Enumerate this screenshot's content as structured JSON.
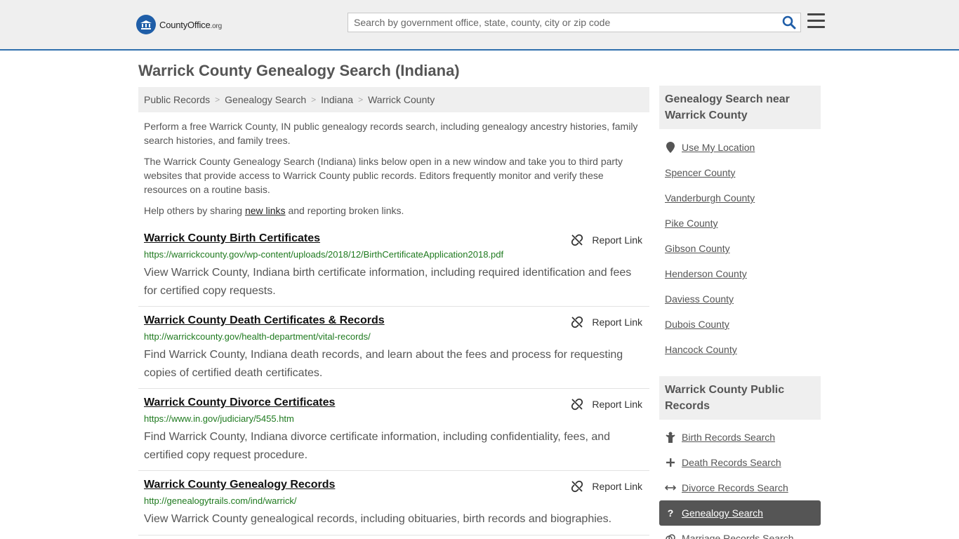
{
  "header": {
    "logo_main": "CountyOffice",
    "logo_tld": ".org",
    "search_placeholder": "Search by government office, state, county, city or zip code"
  },
  "page_title": "Warrick County Genealogy Search (Indiana)",
  "breadcrumb": [
    "Public Records",
    "Genealogy Search",
    "Indiana",
    "Warrick County"
  ],
  "intro": {
    "p1": "Perform a free Warrick County, IN public genealogy records search, including genealogy ancestry histories, family search histories, and family trees.",
    "p2": "The Warrick County Genealogy Search (Indiana) links below open in a new window and take you to third party websites that provide access to Warrick County public records. Editors frequently monitor and verify these resources on a routine basis.",
    "p3_before": "Help others by sharing ",
    "p3_link": "new links",
    "p3_after": " and reporting broken links."
  },
  "report_label": "Report Link",
  "results": [
    {
      "title": "Warrick County Birth Certificates",
      "url": "https://warrickcounty.gov/wp-content/uploads/2018/12/BirthCertificateApplication2018.pdf",
      "desc": "View Warrick County, Indiana birth certificate information, including required identification and fees for certified copy requests."
    },
    {
      "title": "Warrick County Death Certificates & Records",
      "url": "http://warrickcounty.gov/health-department/vital-records/",
      "desc": "Find Warrick County, Indiana death records, and learn about the fees and process for requesting copies of certified death certificates."
    },
    {
      "title": "Warrick County Divorce Certificates",
      "url": "https://www.in.gov/judiciary/5455.htm",
      "desc": "Find Warrick County, Indiana divorce certificate information, including confidentiality, fees, and certified copy request procedure."
    },
    {
      "title": "Warrick County Genealogy Records",
      "url": "http://genealogytrails.com/ind/warrick/",
      "desc": "View Warrick County genealogical records, including obituaries, birth records and biographies."
    }
  ],
  "sidebar": {
    "nearby_title": "Genealogy Search near Warrick County",
    "use_location": "Use My Location",
    "nearby": [
      "Spencer County",
      "Vanderburgh County",
      "Pike County",
      "Gibson County",
      "Henderson County",
      "Daviess County",
      "Dubois County",
      "Hancock County"
    ],
    "records_title": "Warrick County Public Records",
    "records": [
      {
        "label": "Birth Records Search",
        "icon": "baby-icon"
      },
      {
        "label": "Death Records Search",
        "icon": "cross-icon"
      },
      {
        "label": "Divorce Records Search",
        "icon": "arrows-icon"
      },
      {
        "label": "Genealogy Search",
        "icon": "question-icon",
        "active": true
      },
      {
        "label": "Marriage Records Search",
        "icon": "rings-icon"
      }
    ]
  },
  "colors": {
    "accent": "#2f6fad",
    "url_green": "#1f7a1f",
    "active_bg": "#555555"
  }
}
